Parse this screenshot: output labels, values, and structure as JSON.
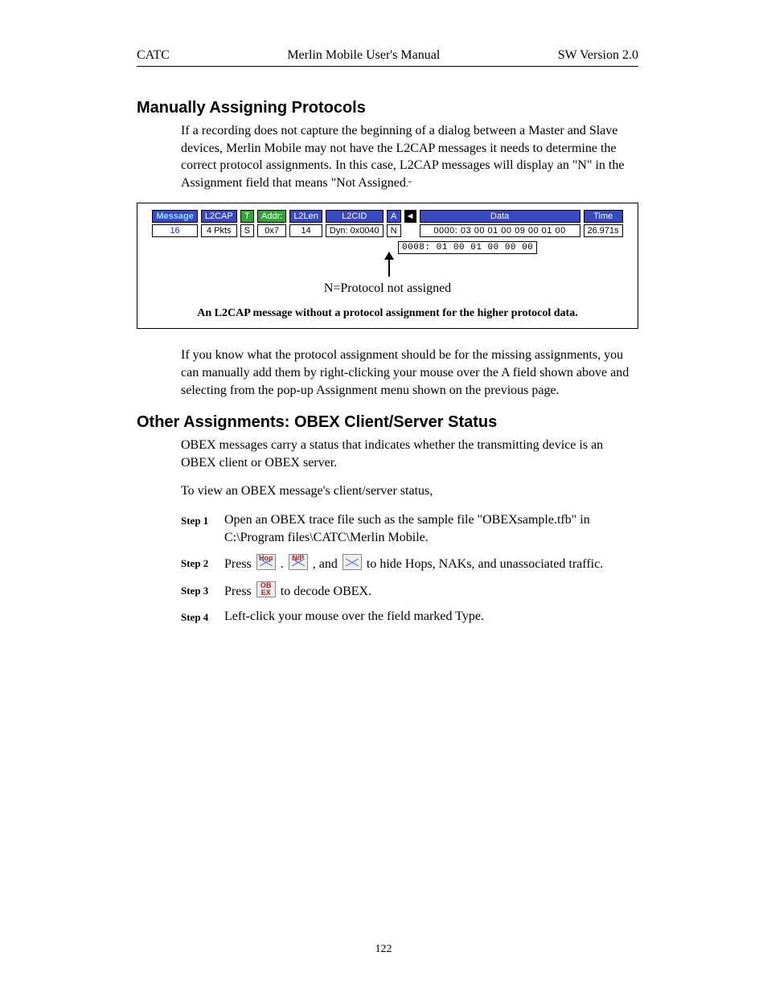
{
  "header": {
    "left": "CATC",
    "center": "Merlin Mobile User's Manual",
    "right": "SW Version 2.0"
  },
  "section1": {
    "title": "Manually Assigning Protocols",
    "para1_a": "If a recording does not capture the beginning of a dialog between a Master and Slave devices, Merlin Mobile may not have the L2CAP messages it needs to determine the correct protocol assignments.  In this case, L2CAP messages will display an \"N\" in the Assignment field that means \"Not Assigned",
    "para1_b": ".\"",
    "para2": "If you know what the protocol assignment should be for the missing assignments, you can manually add them by right-clicking your mouse over the A field shown above and selecting from the pop-up Assignment menu shown on the previous page."
  },
  "figure": {
    "headers": {
      "message": "Message",
      "l2cap": "L2CAP",
      "t": "T",
      "addr": "Addr:",
      "l2len": "L2Len",
      "l2cid": "L2CID",
      "a": "A",
      "arrow": "◄",
      "data": "Data",
      "time": "Time"
    },
    "values": {
      "message": "16",
      "l2cap": "4 Pkts",
      "t": "S",
      "addr": "0x7",
      "l2len": "14",
      "l2cid": "Dyn: 0x0040",
      "a": "N",
      "data1": "0000: 03 00 01 00 09 00 01 00",
      "data2": "0008: 01 00 01 00 00 00",
      "time": "26.971s"
    },
    "note": "N=Protocol not assigned",
    "caption": "An L2CAP message without a protocol assignment for the higher protocol data."
  },
  "section2": {
    "title": "Other Assignments: OBEX Client/Server Status",
    "para1": "OBEX messages carry a status that indicates whether the transmitting device is an OBEX client or OBEX server.",
    "para2": "To view an OBEX message's client/server status,",
    "steps": [
      {
        "label": "Step 1",
        "body": "Open an OBEX trace file such as the sample file \"OBEXsample.tfb\" in C:\\Program files\\CATC\\Merlin Mobile."
      },
      {
        "label": "Step 2",
        "body_pre": "Press ",
        "body_mid1": " . ",
        "body_mid2": " , and ",
        "body_post": " to hide Hops, NAKs, and unassociated traffic."
      },
      {
        "label": "Step 3",
        "body_pre": "Press ",
        "body_post": " to decode OBEX."
      },
      {
        "label": "Step 4",
        "body": "Left-click your mouse over the field marked Type."
      }
    ],
    "icons": {
      "hop": "Hop",
      "np": "N/P",
      "unassoc": "",
      "obex_top": "OB",
      "obex_bot": "EX"
    }
  },
  "page_number": "122"
}
